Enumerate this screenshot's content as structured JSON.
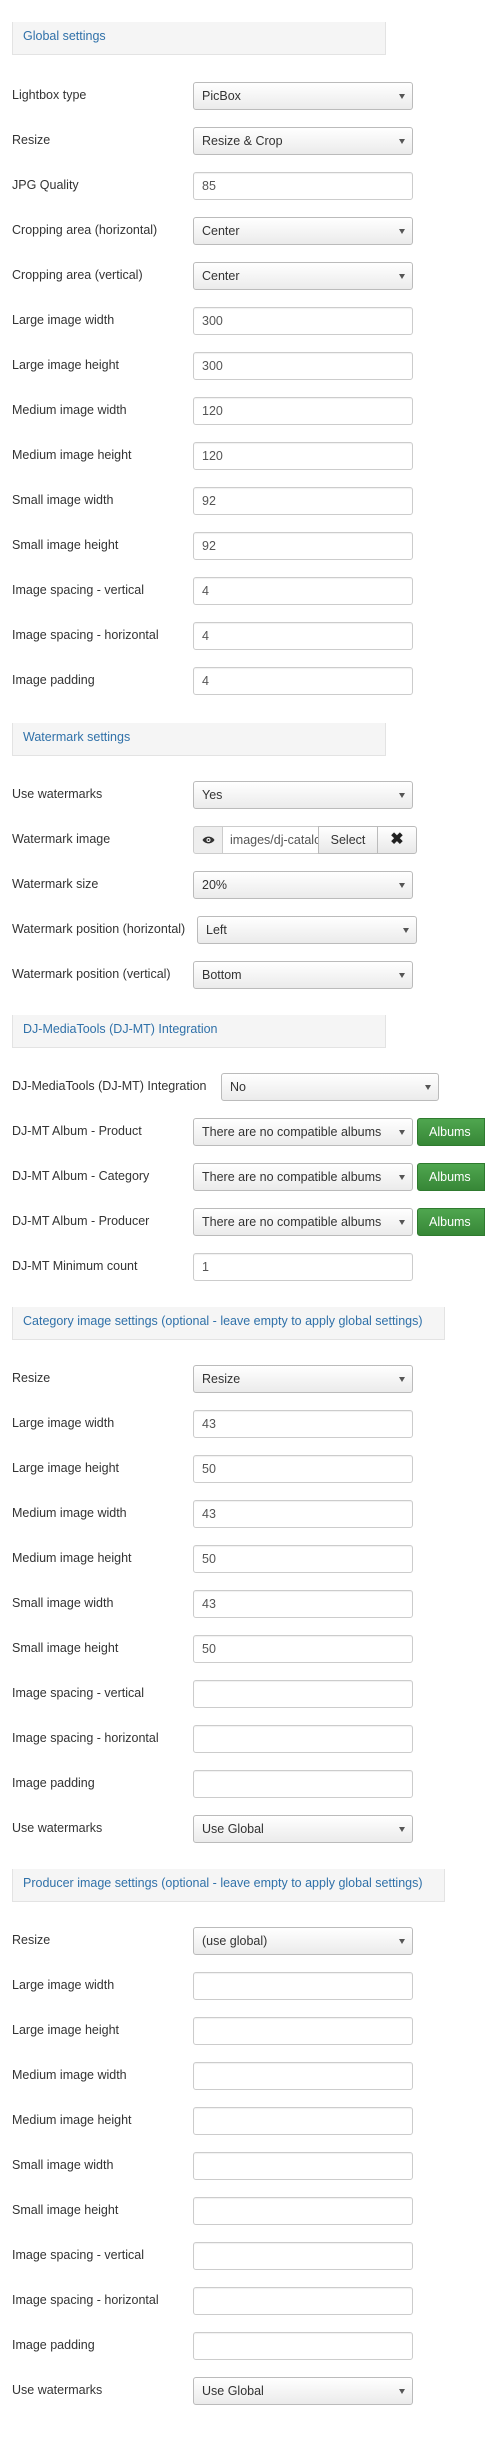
{
  "global": {
    "title": "Global settings",
    "lightbox_type": {
      "label": "Lightbox type",
      "value": "PicBox"
    },
    "resize": {
      "label": "Resize",
      "value": "Resize & Crop"
    },
    "jpg_quality": {
      "label": "JPG Quality",
      "value": "85"
    },
    "crop_h": {
      "label": "Cropping area (horizontal)",
      "value": "Center"
    },
    "crop_v": {
      "label": "Cropping area (vertical)",
      "value": "Center"
    },
    "large_w": {
      "label": "Large image width",
      "value": "300"
    },
    "large_h": {
      "label": "Large image height",
      "value": "300"
    },
    "medium_w": {
      "label": "Medium image width",
      "value": "120"
    },
    "medium_h": {
      "label": "Medium image height",
      "value": "120"
    },
    "small_w": {
      "label": "Small image width",
      "value": "92"
    },
    "small_h": {
      "label": "Small image height",
      "value": "92"
    },
    "spacing_v": {
      "label": "Image spacing - vertical",
      "value": "4"
    },
    "spacing_h": {
      "label": "Image spacing - horizontal",
      "value": "4"
    },
    "padding": {
      "label": "Image padding",
      "value": "4"
    }
  },
  "watermark": {
    "title": "Watermark settings",
    "use": {
      "label": "Use watermarks",
      "value": "Yes"
    },
    "image": {
      "label": "Watermark image",
      "value": "images/dj-catalog",
      "select_label": "Select",
      "clear_label": "✖"
    },
    "size": {
      "label": "Watermark size",
      "value": "20%"
    },
    "pos_h": {
      "label": "Watermark position (horizontal)",
      "value": "Left"
    },
    "pos_v": {
      "label": "Watermark position (vertical)",
      "value": "Bottom"
    }
  },
  "djmt": {
    "title": "DJ-MediaTools (DJ-MT) Integration",
    "integration": {
      "label": "DJ-MediaTools (DJ-MT) Integration",
      "value": "No"
    },
    "album_product": {
      "label": "DJ-MT Album - Product",
      "value": "There are no compatible albums",
      "button": "Albums"
    },
    "album_category": {
      "label": "DJ-MT Album - Category",
      "value": "There are no compatible albums",
      "button": "Albums"
    },
    "album_producer": {
      "label": "DJ-MT Album - Producer",
      "value": "There are no compatible albums",
      "button": "Albums"
    },
    "min_count": {
      "label": "DJ-MT Minimum count",
      "value": "1"
    }
  },
  "category": {
    "title": "Category image settings (optional - leave empty to apply global settings)",
    "resize": {
      "label": "Resize",
      "value": "Resize"
    },
    "large_w": {
      "label": "Large image width",
      "value": "43"
    },
    "large_h": {
      "label": "Large image height",
      "value": "50"
    },
    "medium_w": {
      "label": "Medium image width",
      "value": "43"
    },
    "medium_h": {
      "label": "Medium image height",
      "value": "50"
    },
    "small_w": {
      "label": "Small image width",
      "value": "43"
    },
    "small_h": {
      "label": "Small image height",
      "value": "50"
    },
    "spacing_v": {
      "label": "Image spacing - vertical",
      "value": ""
    },
    "spacing_h": {
      "label": "Image spacing - horizontal",
      "value": ""
    },
    "padding": {
      "label": "Image padding",
      "value": ""
    },
    "watermarks": {
      "label": "Use watermarks",
      "value": "Use Global"
    }
  },
  "producer": {
    "title": "Producer image settings (optional - leave empty to apply global settings)",
    "resize": {
      "label": "Resize",
      "value": "(use global)"
    },
    "large_w": {
      "label": "Large image width",
      "value": ""
    },
    "large_h": {
      "label": "Large image height",
      "value": ""
    },
    "medium_w": {
      "label": "Medium image width",
      "value": ""
    },
    "medium_h": {
      "label": "Medium image height",
      "value": ""
    },
    "small_w": {
      "label": "Small image width",
      "value": ""
    },
    "small_h": {
      "label": "Small image height",
      "value": ""
    },
    "spacing_v": {
      "label": "Image spacing - vertical",
      "value": ""
    },
    "spacing_h": {
      "label": "Image spacing - horizontal",
      "value": ""
    },
    "padding": {
      "label": "Image padding",
      "value": ""
    },
    "watermarks": {
      "label": "Use watermarks",
      "value": "Use Global"
    }
  }
}
